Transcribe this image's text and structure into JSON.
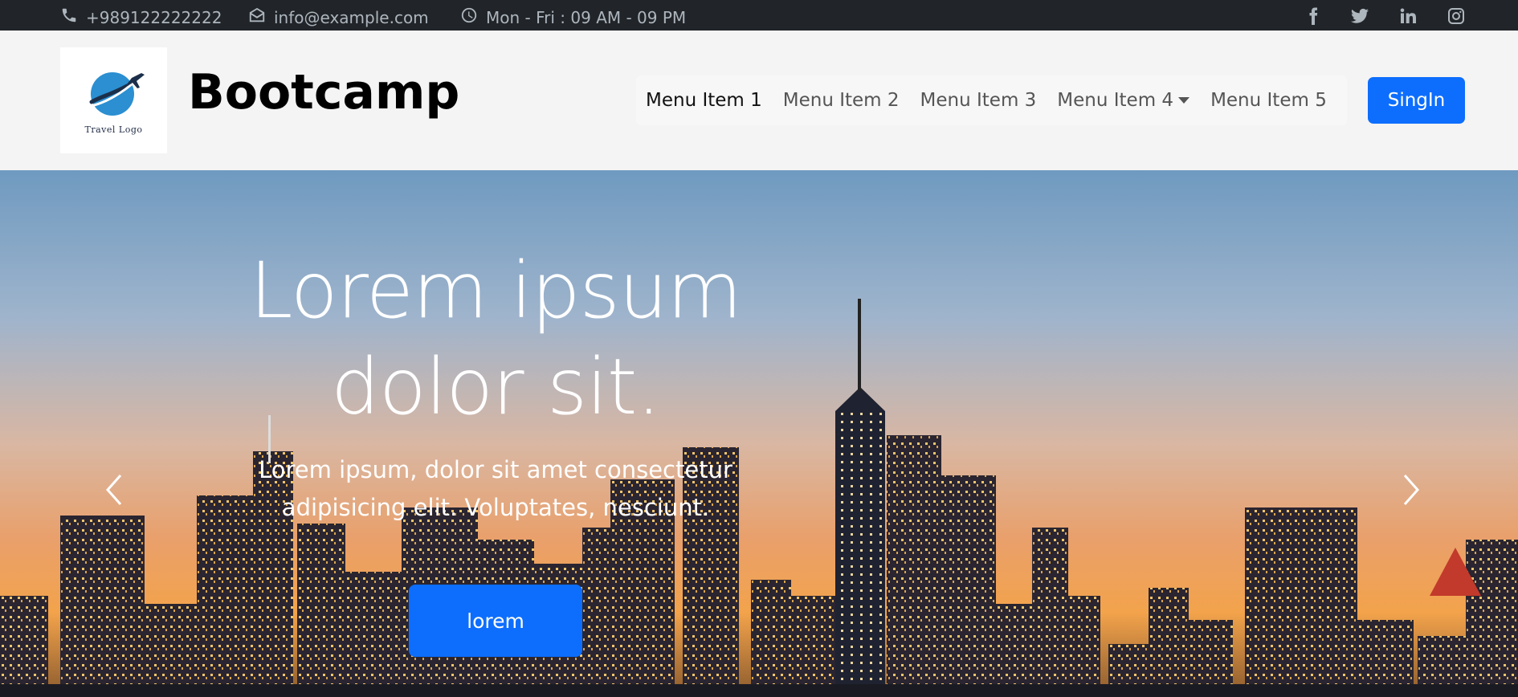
{
  "topbar": {
    "phone": "+989122222222",
    "email": "info@example.com",
    "hours": "Mon - Fri : 09 AM - 09 PM",
    "social_icons": [
      "facebook-icon",
      "twitter-icon",
      "linkedin-icon",
      "instagram-icon"
    ]
  },
  "header": {
    "logo_caption": "Travel Logo",
    "brand": "Bootcamp",
    "nav": {
      "items": [
        {
          "label": "Menu Item 1",
          "active": true
        },
        {
          "label": "Menu Item 2"
        },
        {
          "label": "Menu Item 3"
        },
        {
          "label": "Menu Item 4",
          "dropdown": true
        },
        {
          "label": "Menu Item 5"
        }
      ]
    },
    "signin_label": "SingIn"
  },
  "hero": {
    "title_line1": "Lorem ipsum",
    "title_line2": "dolor sit.",
    "text_line1": "Lorem ipsum, dolor sit amet consectetur",
    "text_line2": "adipisicing elit. Voluptates, nesciunt.",
    "button_label": "lorem"
  },
  "colors": {
    "topbar_bg": "#212529",
    "header_bg": "#f4f4f4",
    "primary": "#0d6efd"
  }
}
